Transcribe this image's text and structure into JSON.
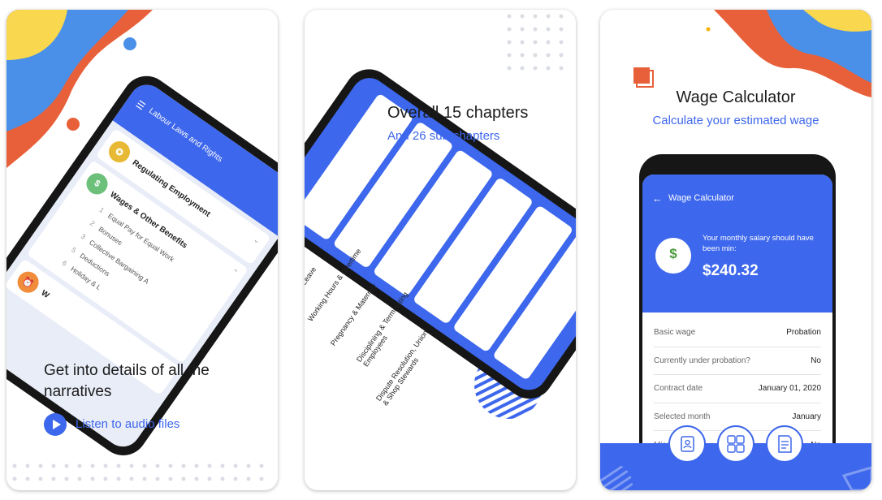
{
  "card1": {
    "headline": "Get into details of all the narratives",
    "audio_link": "Listen to audio files",
    "phone": {
      "app_title": "Labour Laws and Rights",
      "chapters": [
        {
          "title": "Regulating Employment",
          "icon": "badge-icon"
        },
        {
          "title": "Wages & Other Benefits",
          "icon": "money-icon",
          "subs": [
            {
              "n": "1",
              "label": "Equal Pay for Equal Work"
            },
            {
              "n": "2",
              "label": "Bonuses"
            },
            {
              "n": "3",
              "label": "Collective Bargaining A"
            },
            {
              "n": "5",
              "label": "Deductions"
            },
            {
              "n": "6",
              "label": "Holiday & L"
            }
          ]
        },
        {
          "title": "W",
          "icon": "alarm-icon"
        }
      ]
    }
  },
  "card2": {
    "title": "Overall 15 chapters",
    "subtitle": "And 26 sub-chapters",
    "phone": {
      "items": [
        {
          "title": "greement"
        },
        {
          "title": "Leave"
        },
        {
          "title": "Working Hours & Overtime"
        },
        {
          "title": "Pregnancy & Maternity"
        },
        {
          "title": "Disciplining & Terminating Employees"
        },
        {
          "title": "Dispute Resolution, Union & Shop Stewards"
        }
      ]
    }
  },
  "card3": {
    "title": "Wage Calculator",
    "subtitle": "Calculate your estimated wage",
    "phone": {
      "app_title": "Wage Calculator",
      "result_label": "Your monthly salary should have been min:",
      "result_value": "$240.32",
      "rows": [
        {
          "label": "Basic wage",
          "value": "Probation"
        },
        {
          "label": "Currently under probation?",
          "value": "No"
        },
        {
          "label": "Contract date",
          "value": "January 01, 2020"
        },
        {
          "label": "Selected month",
          "value": "January"
        },
        {
          "label": "Miss",
          "value": "No"
        }
      ]
    },
    "bottom_icons": [
      "contacts-icon",
      "calculator-icon",
      "document-icon"
    ]
  },
  "colors": {
    "accent": "#3d67ec",
    "blob_blue": "#4a90e8",
    "blob_yellow": "#f9d74e",
    "blob_orange": "#e8603a"
  }
}
